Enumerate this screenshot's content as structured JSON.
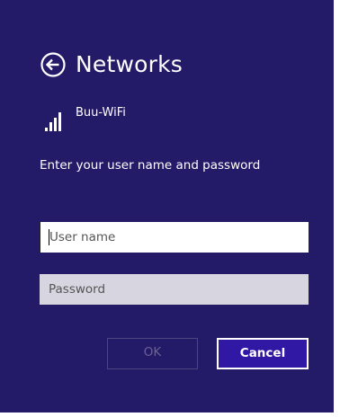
{
  "header": {
    "title": "Networks",
    "back_icon": "arrow-left-circle-icon"
  },
  "network": {
    "name": "Buu-WiFi",
    "signal_icon": "wifi-signal-bars-icon"
  },
  "form": {
    "prompt": "Enter your user name and password",
    "username_placeholder": "User name",
    "username_value": "",
    "password_placeholder": "Password",
    "password_value": ""
  },
  "buttons": {
    "ok_label": "OK",
    "cancel_label": "Cancel"
  },
  "colors": {
    "panel_background": "#231a68",
    "accent": "#3018a4",
    "disabled_field": "#d6d5e0"
  }
}
